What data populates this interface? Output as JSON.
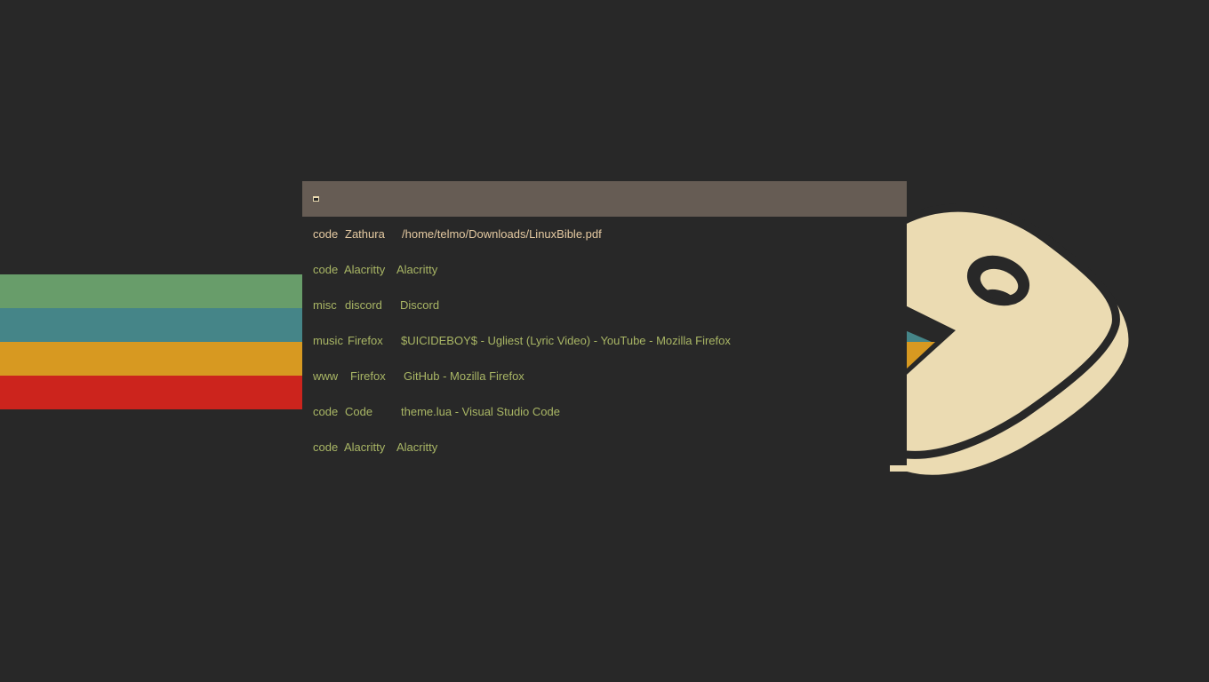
{
  "colors": {
    "background": "#282828",
    "header": "#665c54",
    "text_selected": "#e4c9a1",
    "text_normal": "#a9b665",
    "stripe_green": "#689d6a",
    "stripe_teal": "#458588",
    "stripe_yellow": "#d79921",
    "stripe_red": "#cc241d",
    "logo_cream": "#ebdbb2"
  },
  "header": {
    "icon": "window-icon"
  },
  "windows": [
    {
      "tag": "code",
      "class": "Zathura",
      "title": "/home/telmo/Downloads/LinuxBible.pdf",
      "selected": true
    },
    {
      "tag": "code",
      "class": "Alacritty",
      "title": "Alacritty"
    },
    {
      "tag": "misc",
      "class": "discord",
      "title": "Discord"
    },
    {
      "tag": "music",
      "class": "Firefox",
      "title": "$UICIDEBOY$ - Ugliest (Lyric Video) - YouTube - Mozilla Firefox"
    },
    {
      "tag": "www",
      "class": "Firefox",
      "title": "GitHub - Mozilla Firefox"
    },
    {
      "tag": "code",
      "class": "Code",
      "title": "theme.lua - Visual Studio Code"
    },
    {
      "tag": "code",
      "class": "Alacritty",
      "title": "Alacritty"
    }
  ]
}
